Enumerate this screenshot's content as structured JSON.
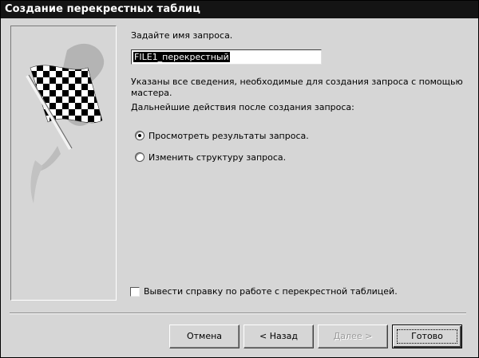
{
  "window": {
    "title": "Создание перекрестных таблиц"
  },
  "prompt": "Задайте имя запроса.",
  "query_name": "FILE1_перекрестный",
  "info": {
    "line1": "Указаны все сведения, необходимые для создания запроса с помощью",
    "line2": "мастера.",
    "line3": "Дальнейшие действия после создания запроса:"
  },
  "options": [
    {
      "label": "Просмотреть результаты запроса.",
      "selected": true
    },
    {
      "label": "Изменить структуру запроса.",
      "selected": false
    }
  ],
  "help_checkbox": {
    "label": "Вывести справку по работе с перекрестной таблицей.",
    "checked": false
  },
  "buttons": {
    "cancel": "Отмена",
    "back": "< Назад",
    "next": "Далее >",
    "finish": "Готово"
  }
}
